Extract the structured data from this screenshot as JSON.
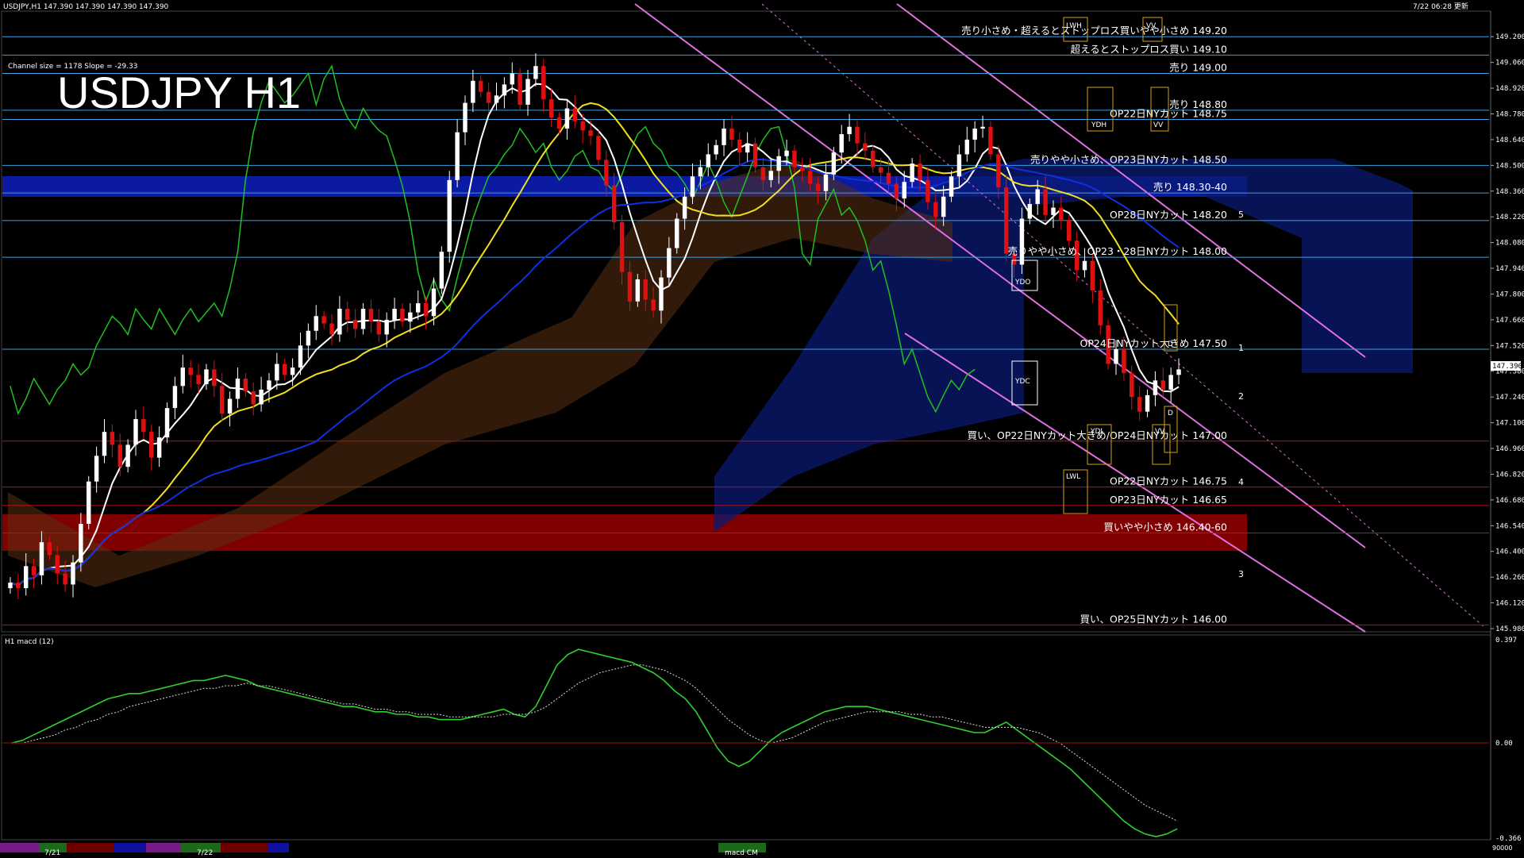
{
  "header": {
    "symbol_info": "USDJPY,H1  147.390 147.390 147.390 147.390",
    "datetime": "7/22 06:28 更新",
    "channel_info": "Channel size = 1178 Slope = -29.33",
    "big_title": "USDJPY H1"
  },
  "colors": {
    "bull": "#ffffff",
    "bear": "#e01010",
    "ma_white": "#ffffff",
    "ma_yellow": "#f0e020",
    "ma_blue": "#1030e0",
    "chikou_green": "#20c020",
    "channel_pink": "#e070e0",
    "res_line": "#3aa0e0",
    "sup_line": "#c01010",
    "macd_green": "#30d030",
    "macd_pink": "#f080a0"
  },
  "chart_data": [
    {
      "type": "candlestick",
      "symbol": "USDJPY",
      "timeframe": "H1",
      "ylim": [
        145.98,
        149.27
      ],
      "y_ticks": [
        "149.200",
        "149.060",
        "148.920",
        "148.780",
        "148.640",
        "148.500",
        "148.360",
        "148.220",
        "148.080",
        "147.940",
        "147.800",
        "147.660",
        "147.520",
        "147.380",
        "147.240",
        "147.100",
        "146.960",
        "146.820",
        "146.680",
        "146.540",
        "146.400",
        "146.260",
        "146.120",
        "145.980"
      ],
      "current_price": "147.390",
      "closes": [
        146.23,
        146.2,
        146.32,
        146.27,
        146.45,
        146.38,
        146.28,
        146.22,
        146.34,
        146.55,
        146.78,
        146.92,
        147.05,
        146.98,
        146.86,
        146.98,
        147.12,
        147.05,
        146.91,
        147.02,
        147.18,
        147.3,
        147.4,
        147.36,
        147.31,
        147.39,
        147.3,
        147.15,
        147.23,
        147.34,
        147.27,
        147.2,
        147.28,
        147.33,
        147.42,
        147.36,
        147.4,
        147.52,
        147.6,
        147.68,
        147.64,
        147.58,
        147.72,
        147.66,
        147.61,
        147.72,
        147.65,
        147.58,
        147.66,
        147.72,
        147.65,
        147.7,
        147.75,
        147.68,
        147.83,
        148.03,
        148.42,
        148.68,
        148.84,
        148.96,
        148.9,
        148.84,
        148.88,
        148.94,
        149.0,
        148.83,
        148.97,
        149.04,
        148.86,
        148.76,
        148.7,
        148.81,
        148.74,
        148.69,
        148.66,
        148.53,
        148.39,
        148.19,
        147.92,
        147.76,
        147.88,
        147.77,
        147.71,
        147.89,
        148.05,
        148.21,
        148.33,
        148.44,
        148.49,
        148.56,
        148.61,
        148.7,
        148.64,
        148.57,
        148.62,
        148.49,
        148.42,
        148.47,
        148.55,
        148.58,
        148.49,
        148.47,
        148.4,
        148.36,
        148.45,
        148.57,
        148.67,
        148.71,
        148.62,
        148.58,
        148.49,
        148.46,
        148.4,
        148.32,
        148.41,
        148.51,
        148.42,
        148.3,
        148.22,
        148.33,
        148.44,
        148.56,
        148.64,
        148.7,
        148.71,
        148.56,
        148.38,
        148.02,
        147.96,
        148.21,
        148.29,
        148.37,
        148.23,
        148.27,
        148.2,
        148.09,
        147.93,
        147.98,
        147.82,
        147.63,
        147.42,
        147.5,
        147.37,
        147.24,
        147.16,
        147.25,
        147.33,
        147.28,
        147.36,
        147.39
      ],
      "support_resistance": [
        {
          "label": "売り小さめ・超えるとストップロス買いやや小さめ 149.20",
          "price": 149.2
        },
        {
          "label": "超えるとストップロス買い 149.10",
          "price": 149.1
        },
        {
          "label": "売り 149.00",
          "price": 149.0
        },
        {
          "label": "売り 148.80",
          "price": 148.8
        },
        {
          "label": "OP22日NYカット 148.75",
          "price": 148.75
        },
        {
          "label": "売りやや小さめ、OP23日NYカット 148.50",
          "price": 148.5
        },
        {
          "label": "売り 148.30-40",
          "price": 148.35
        },
        {
          "label": "OP28日NYカット 148.20",
          "price": 148.2
        },
        {
          "label": "売りやや小さめ、OP23・28日NYカット 148.00",
          "price": 148.0
        },
        {
          "label": "OP24日NYカット大きめ 147.50",
          "price": 147.5
        },
        {
          "label": "買い、OP22日NYカット大きめ/OP24日NYカット 147.00",
          "price": 147.0
        },
        {
          "label": "OP22日NYカット 146.75",
          "price": 146.75
        },
        {
          "label": "OP23日NYカット 146.65",
          "price": 146.65
        },
        {
          "label": "買いやや小さめ 146.40-60",
          "price": 146.5
        },
        {
          "label": "買い、OP25日NYカット 146.00",
          "price": 146.0
        }
      ],
      "box_labels": [
        "LWH",
        "VV",
        "YDH",
        "VV",
        "YDO",
        "YDC",
        "YDL",
        "VV",
        "LWL",
        "D",
        "D"
      ],
      "wave_labels": [
        "1",
        "2",
        "3",
        "4",
        "5"
      ]
    },
    {
      "type": "line",
      "title": "H1 macd (12)",
      "ylim": [
        -0.366,
        0.397
      ],
      "y_ticks": [
        "0.397",
        "0.00",
        "-0.366"
      ],
      "macd": [
        0.0,
        0.01,
        0.03,
        0.05,
        0.07,
        0.09,
        0.11,
        0.13,
        0.15,
        0.17,
        0.18,
        0.19,
        0.19,
        0.2,
        0.21,
        0.22,
        0.23,
        0.24,
        0.24,
        0.25,
        0.26,
        0.25,
        0.24,
        0.22,
        0.21,
        0.2,
        0.19,
        0.18,
        0.17,
        0.16,
        0.15,
        0.14,
        0.14,
        0.13,
        0.12,
        0.12,
        0.11,
        0.11,
        0.1,
        0.1,
        0.09,
        0.09,
        0.09,
        0.1,
        0.11,
        0.12,
        0.13,
        0.11,
        0.1,
        0.14,
        0.22,
        0.3,
        0.34,
        0.36,
        0.35,
        0.34,
        0.33,
        0.32,
        0.31,
        0.29,
        0.27,
        0.24,
        0.2,
        0.17,
        0.12,
        0.05,
        -0.02,
        -0.07,
        -0.09,
        -0.07,
        -0.03,
        0.01,
        0.04,
        0.06,
        0.08,
        0.1,
        0.12,
        0.13,
        0.14,
        0.14,
        0.14,
        0.13,
        0.12,
        0.11,
        0.1,
        0.09,
        0.08,
        0.07,
        0.06,
        0.05,
        0.04,
        0.04,
        0.06,
        0.08,
        0.05,
        0.02,
        -0.01,
        -0.04,
        -0.07,
        -0.1,
        -0.14,
        -0.18,
        -0.22,
        -0.26,
        -0.3,
        -0.33,
        -0.35,
        -0.36,
        -0.35,
        -0.33
      ],
      "signal": [
        0.0,
        0.0,
        0.01,
        0.02,
        0.03,
        0.05,
        0.06,
        0.08,
        0.09,
        0.11,
        0.12,
        0.14,
        0.15,
        0.16,
        0.17,
        0.18,
        0.19,
        0.2,
        0.21,
        0.21,
        0.22,
        0.22,
        0.23,
        0.22,
        0.22,
        0.21,
        0.2,
        0.19,
        0.18,
        0.17,
        0.16,
        0.15,
        0.15,
        0.14,
        0.13,
        0.13,
        0.12,
        0.12,
        0.11,
        0.11,
        0.11,
        0.1,
        0.1,
        0.1,
        0.1,
        0.1,
        0.11,
        0.11,
        0.11,
        0.12,
        0.14,
        0.17,
        0.2,
        0.23,
        0.25,
        0.27,
        0.28,
        0.29,
        0.3,
        0.3,
        0.29,
        0.28,
        0.26,
        0.24,
        0.21,
        0.17,
        0.13,
        0.09,
        0.06,
        0.03,
        0.01,
        0.0,
        0.01,
        0.02,
        0.04,
        0.06,
        0.08,
        0.09,
        0.1,
        0.11,
        0.12,
        0.12,
        0.12,
        0.12,
        0.11,
        0.11,
        0.1,
        0.1,
        0.09,
        0.08,
        0.07,
        0.06,
        0.06,
        0.06,
        0.06,
        0.05,
        0.04,
        0.02,
        0.0,
        -0.03,
        -0.06,
        -0.09,
        -0.12,
        -0.15,
        -0.18,
        -0.21,
        -0.24,
        -0.26,
        -0.28,
        -0.3
      ]
    }
  ],
  "macd_title": "H1 macd (12)",
  "bottom_axis": {
    "date1": "7/21",
    "date2": "7/22",
    "tab_label": "macd CM",
    "corner": "90000"
  }
}
